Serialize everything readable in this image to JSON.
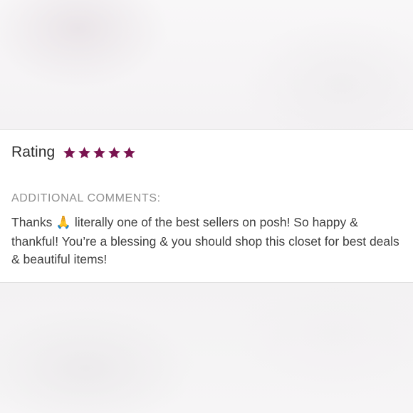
{
  "review": {
    "rating_label": "Rating",
    "rating_value": 5,
    "rating_max": 5,
    "star_color": "#7a1450",
    "comments_heading": "ADDITIONAL COMMENTS:",
    "comment_part1": "Thanks ",
    "comment_emoji": "🙏",
    "comment_part2": " literally one of the best sellers on posh! So happy & thankful! You’re a blessing & you should shop this closet for best deals & beautiful items!"
  },
  "icons": {
    "star": "star-icon",
    "emoji": "folded-hands-emoji"
  }
}
